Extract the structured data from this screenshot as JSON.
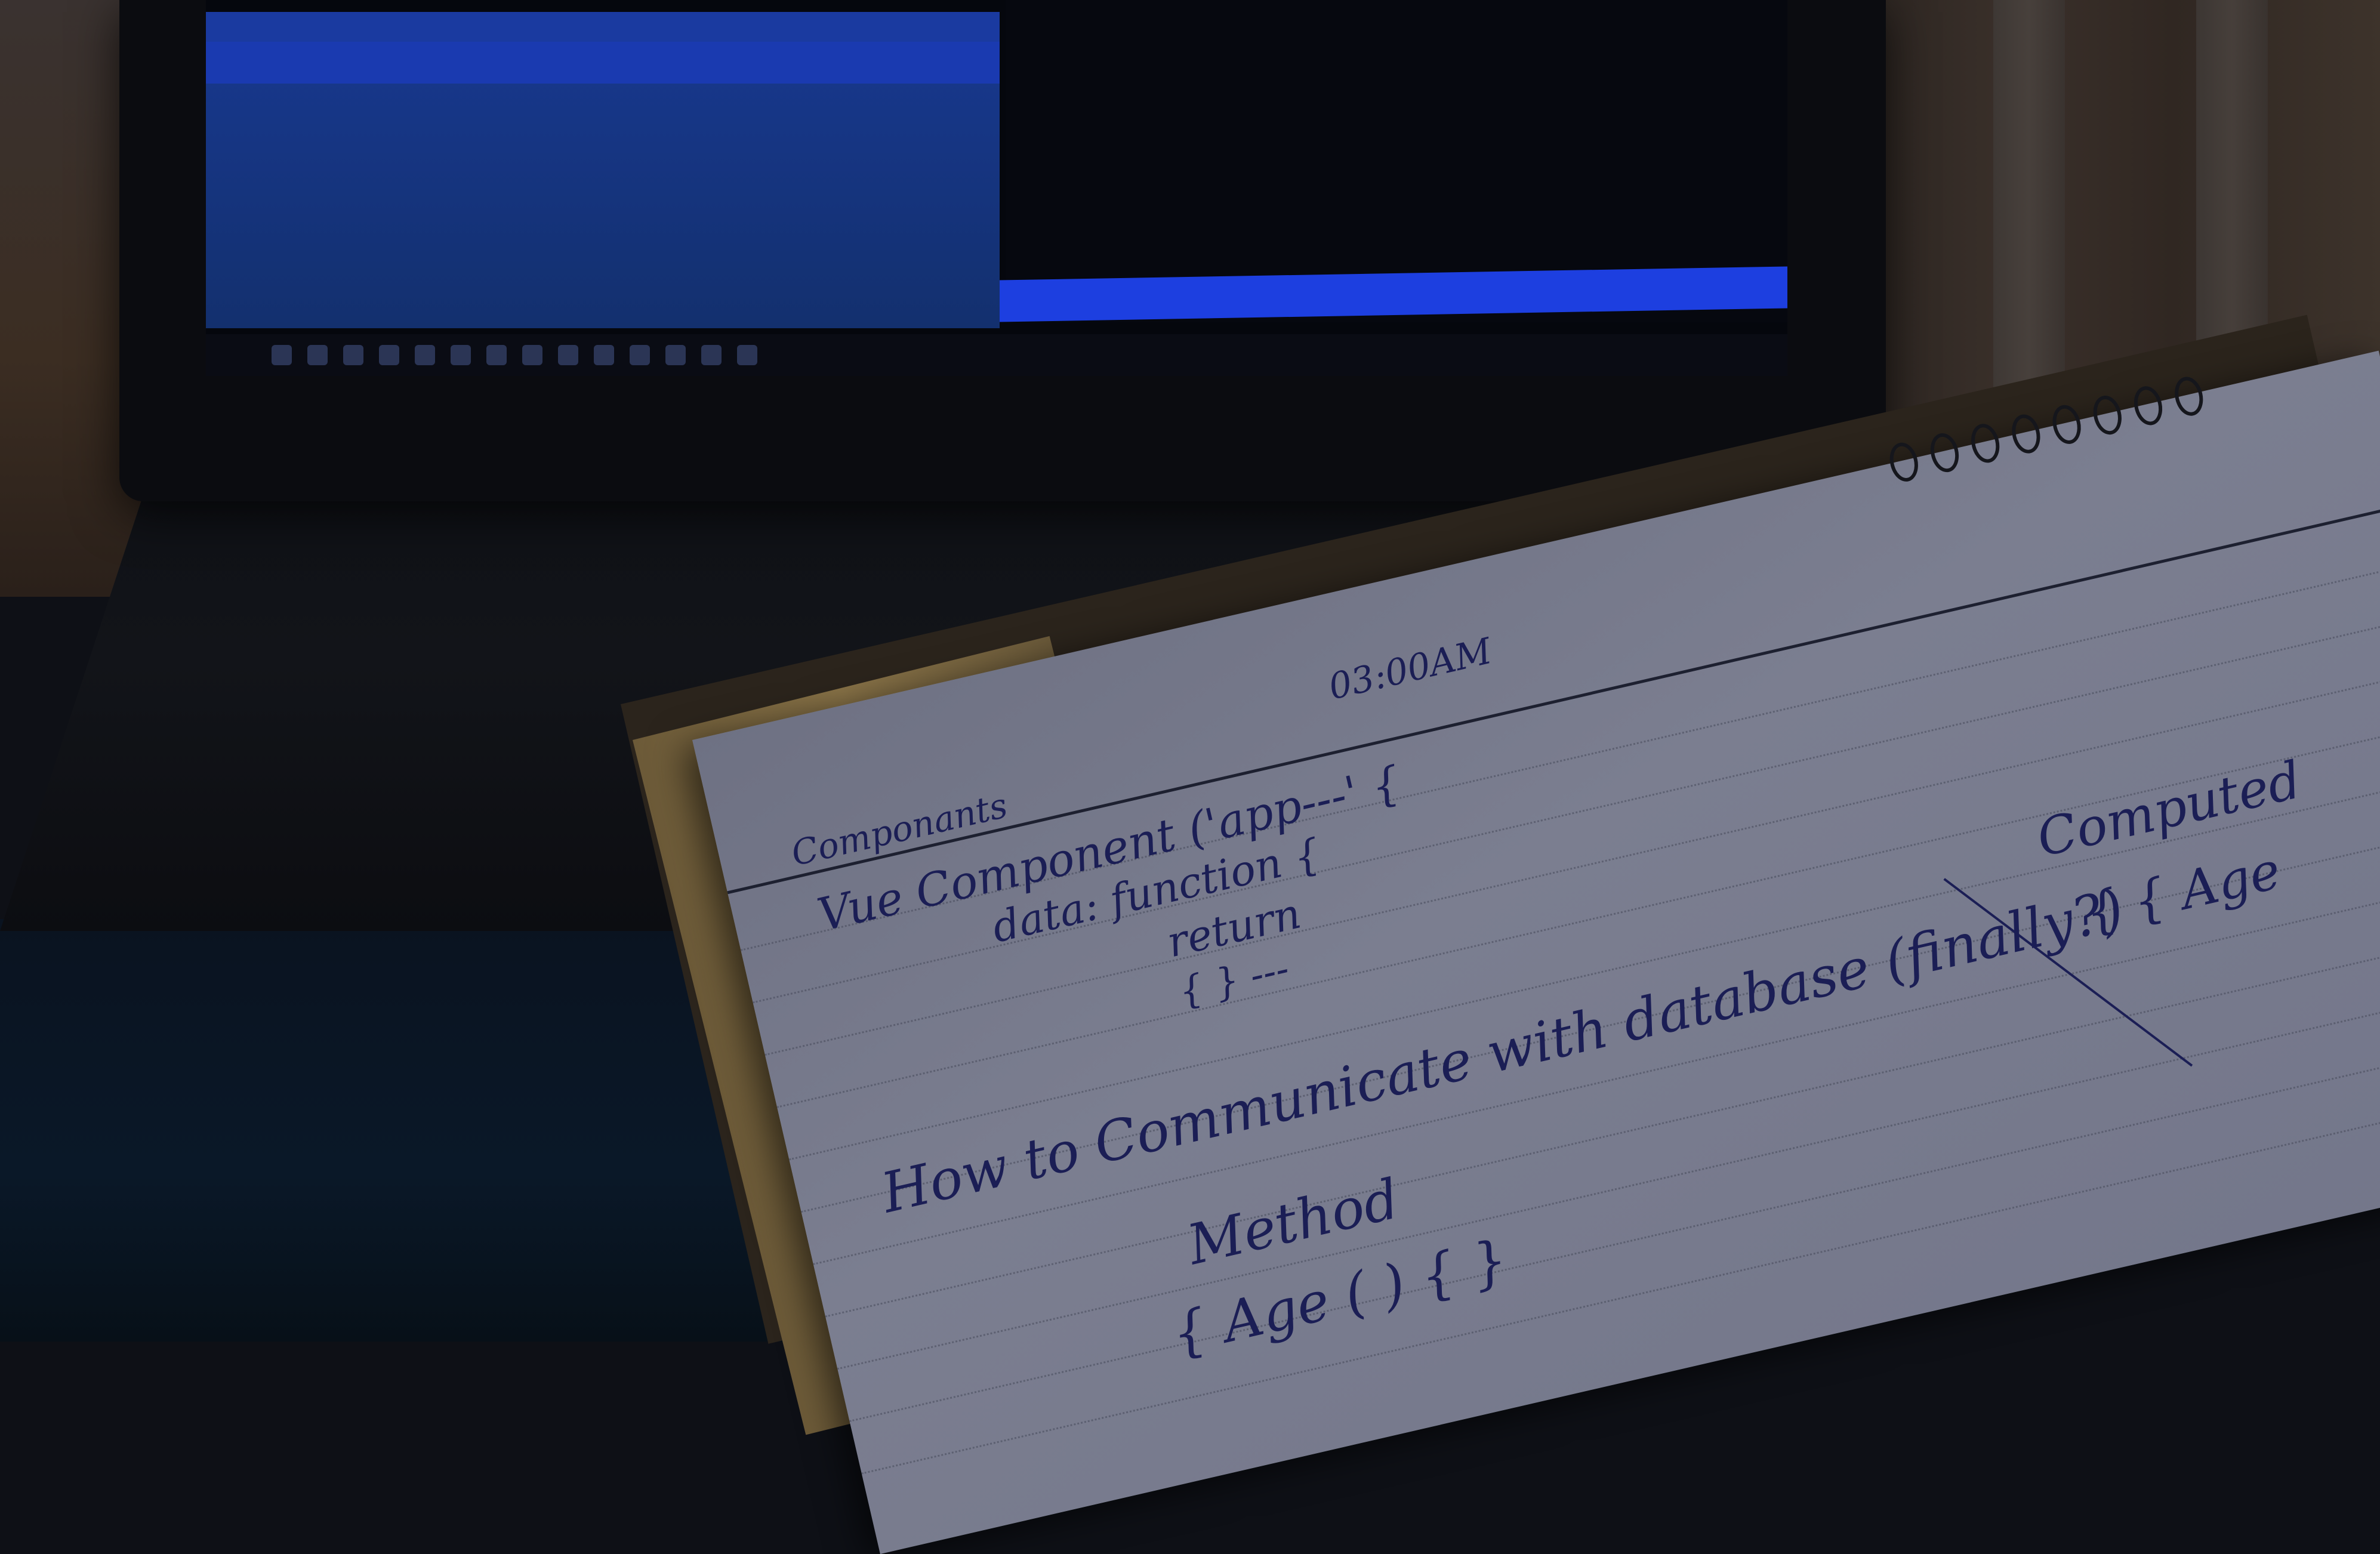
{
  "scene": {
    "description_tags": [
      "laptop",
      "notebook",
      "handwriting",
      "desk"
    ],
    "colors": {
      "ink": "#1b1e55",
      "paper": "#7b7e90",
      "screen_blue": "#17378a",
      "status_bar": "#1d3fe0"
    }
  },
  "laptop": {
    "taskbar_icon_count": 14
  },
  "notebook": {
    "header_time": "03:00AM",
    "title": "Componants",
    "line1": "Vue Component ('app---' {",
    "line2": "data: function {",
    "line3": "return",
    "line4": "{ } --- ",
    "question": "How to Communicate with database (finally?)",
    "method_label": "Method",
    "method_code": "{ Age ( ) { }",
    "computed_label": "Computed",
    "computed_code": "{ { Age"
  }
}
